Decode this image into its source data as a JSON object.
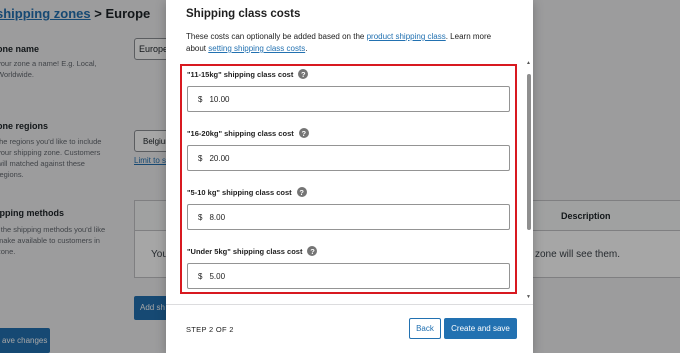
{
  "background": {
    "breadcrumb_link": "shipping zones",
    "breadcrumb_sep": " > ",
    "breadcrumb_current": "Europe",
    "zone_name_label": "one name",
    "zone_name_help": "your zone a name! E.g. Local, Worldwide.",
    "zone_name_value": "Europe",
    "zone_regions_label": "one regions",
    "zone_regions_help": "the regions you'd like to include your shipping zone. Customers will matched against these regions.",
    "region_value": "Belgium",
    "limit_link": "Limit to s",
    "shipping_methods_label": "ipping methods",
    "shipping_methods_help": "l the shipping methods you'd like make available to customers in zone.",
    "table_description_header": "Description",
    "table_you": "You",
    "table_zone_text": "zone will see them.",
    "add_button": "Add sh",
    "save_button": "ave changes"
  },
  "modal": {
    "title": "Shipping class costs",
    "desc_1": "These costs can optionally be added based on the ",
    "desc_link_1": "product shipping class",
    "desc_2": ". Learn more about ",
    "desc_link_2": "setting shipping class costs",
    "desc_3": ".",
    "fields": [
      {
        "label": "\"11-15kg\" shipping class cost",
        "currency": "$",
        "value": "10.00"
      },
      {
        "label": "\"16-20kg\" shipping class cost",
        "currency": "$",
        "value": "20.00"
      },
      {
        "label": "\"5-10 kg\" shipping class cost",
        "currency": "$",
        "value": "8.00"
      },
      {
        "label": "\"Under 5kg\" shipping class cost",
        "currency": "$",
        "value": "5.00"
      }
    ],
    "help_glyph": "?",
    "step": "STEP 2 OF 2",
    "back_label": "Back",
    "save_label": "Create and save"
  }
}
